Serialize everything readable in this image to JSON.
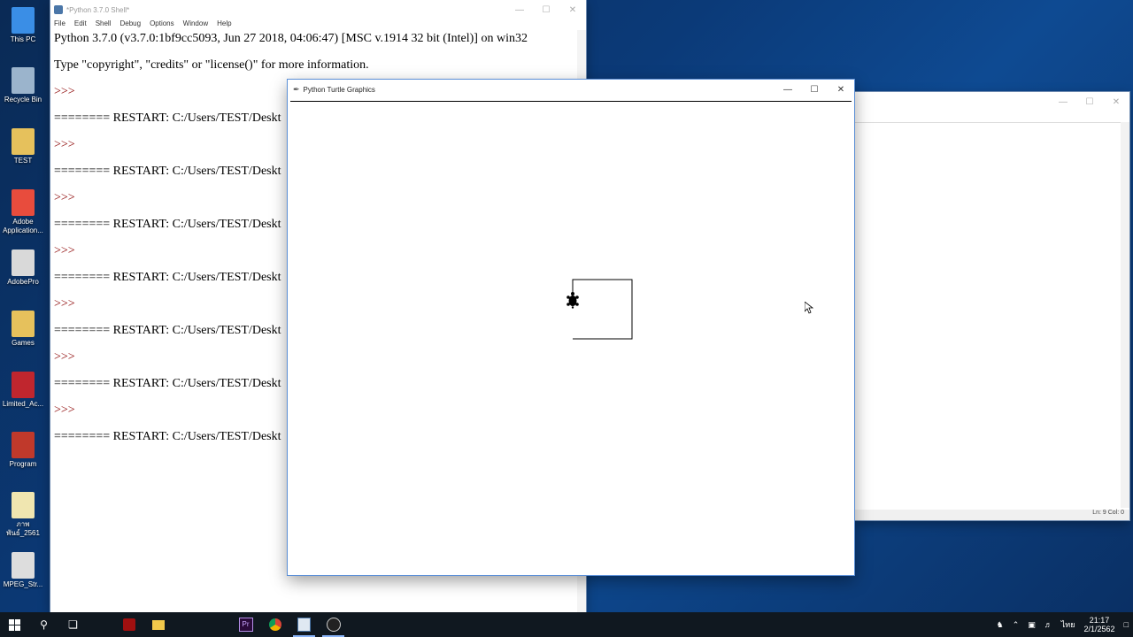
{
  "desktop": {
    "icons": [
      {
        "label": "This PC",
        "color": "#3a8ee6"
      },
      {
        "label": "Recycle Bin",
        "color": "#9bb4cc"
      },
      {
        "label": "TEST",
        "color": "#e6c15c"
      },
      {
        "label": "Adobe Application...",
        "color": "#e84c3d"
      },
      {
        "label": "AdobePro",
        "color": "#d9d9d9"
      },
      {
        "label": "Games",
        "color": "#e6c15c"
      },
      {
        "label": "Limited_Ac...",
        "color": "#c0262e"
      },
      {
        "label": "Program",
        "color": "#c0392b"
      },
      {
        "label": "ภาพ พันธ์_2561",
        "color": "#f0e6b0"
      },
      {
        "label": "MPEG_Str...",
        "color": "#dddddd"
      }
    ]
  },
  "shell": {
    "title": "*Python 3.7.0 Shell*",
    "menu": [
      "File",
      "Edit",
      "Shell",
      "Debug",
      "Options",
      "Window",
      "Help"
    ],
    "banner1": "Python 3.7.0 (v3.7.0:1bf9cc5093, Jun 27 2018, 04:06:47) [MSC v.1914 32 bit (Intel)] on win32",
    "banner2": "Type \"copyright\", \"credits\" or \"license()\" for more information.",
    "prompt": ">>>",
    "restart": "======== RESTART: C:/Users/TEST/Deskt"
  },
  "editor": {
    "status": "Ln: 9   Col: 0"
  },
  "turtle": {
    "title": "Python Turtle Graphics"
  },
  "taskbar": {
    "time": "21:17",
    "date": "2/1/2562",
    "lang": "ไทย"
  }
}
